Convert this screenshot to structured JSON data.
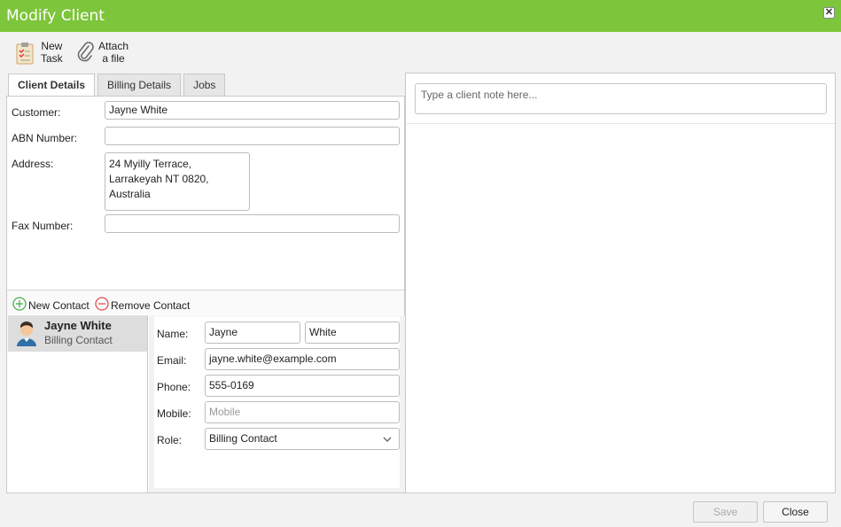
{
  "window": {
    "title": "Modify Client"
  },
  "toolbar": {
    "new_task": "New\nTask",
    "attach_file": "Attach\na file"
  },
  "tabs": [
    "Client Details",
    "Billing Details",
    "Jobs"
  ],
  "client": {
    "customer_label": "Customer:",
    "customer_value": "Jayne White",
    "abn_label": "ABN Number:",
    "abn_value": "",
    "address_label": "Address:",
    "address_value": "24 Myilly Terrace,\nLarrakeyah NT 0820,\nAustralia",
    "fax_label": "Fax Number:",
    "fax_value": ""
  },
  "contacts_bar": {
    "new_contact": "New Contact",
    "remove_contact": "Remove Contact"
  },
  "contacts": [
    {
      "name": "Jayne White",
      "role": "Billing Contact"
    }
  ],
  "contact_form": {
    "name_label": "Name:",
    "first_name": "Jayne",
    "last_name": "White",
    "email_label": "Email:",
    "email": "jayne.white@example.com",
    "phone_label": "Phone:",
    "phone": "555-0169",
    "mobile_label": "Mobile:",
    "mobile_placeholder": "Mobile",
    "role_label": "Role:",
    "role": "Billing Contact"
  },
  "notes": {
    "placeholder": "Type a client note here..."
  },
  "footer": {
    "save": "Save",
    "close": "Close"
  },
  "colors": {
    "titlebar": "#7dc53a",
    "add_icon": "#4caf50",
    "remove_icon": "#e05050"
  },
  "icons": {
    "new_task": "task-clipboard-icon",
    "attach": "paperclip-icon",
    "close": "close-icon",
    "avatar": "person-avatar-icon",
    "chevron": "chevron-down-icon"
  }
}
